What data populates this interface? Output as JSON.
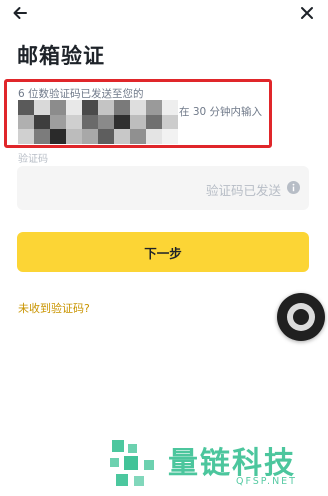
{
  "header": {
    "back_icon": "arrow-left-icon",
    "close_icon": "close-icon"
  },
  "page": {
    "title": "邮箱验证"
  },
  "info": {
    "line1": "6 位数验证码已发送至您的",
    "line2": "在 30 分钟内输入",
    "email_redacted": true
  },
  "code_field": {
    "label": "验证码",
    "status": "验证码已发送",
    "info_icon": "info-icon"
  },
  "actions": {
    "next_label": "下一步",
    "resend_label": "未收到验证码?"
  },
  "colors": {
    "accent_yellow": "#fcd535",
    "link_gold": "#c99400",
    "annotation_red": "#e0262a",
    "watermark_green": "#2dbd8d"
  },
  "watermark": {
    "text": "量链科技",
    "sub": "QFSP.NET"
  }
}
